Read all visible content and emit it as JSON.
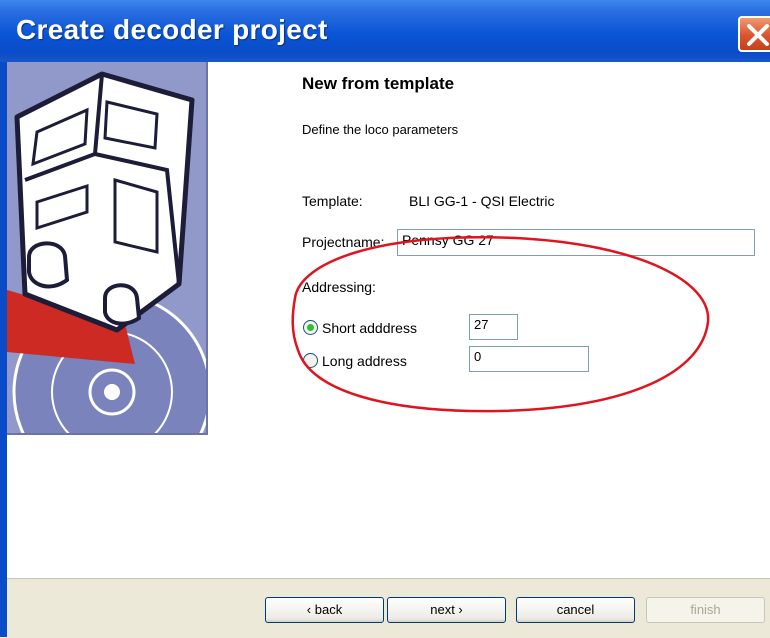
{
  "window": {
    "title": "Create decoder project"
  },
  "page": {
    "heading": "New from template",
    "subheading": "Define the loco parameters"
  },
  "form": {
    "template_label": "Template:",
    "template_value": "BLI GG-1 - QSI Electric",
    "project_name_label": "Projectname:",
    "project_name_value": "Pennsy GG 27",
    "addressing_label": "Addressing:",
    "short_address_label": "Short adddress",
    "short_address_value": "27",
    "short_address_selected": true,
    "long_address_label": "Long address",
    "long_address_value": "0"
  },
  "buttons": {
    "back": "‹ back",
    "next": "next ›",
    "cancel": "cancel",
    "finish": "finish"
  },
  "colors": {
    "titlebar": "#0a55d6",
    "banner": "#8f97c7",
    "annotation": "#e0141e",
    "radio_selected": "#2fbf2f"
  },
  "icons": {
    "close": "close-x-icon",
    "banner": "locomotive-cd-illustration"
  }
}
